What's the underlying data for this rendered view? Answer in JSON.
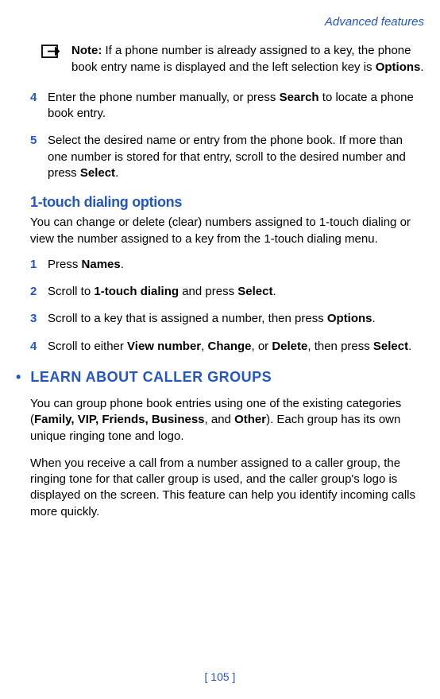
{
  "header": {
    "title": "Advanced features"
  },
  "note": {
    "label": "Note:",
    "text": " If a phone number is already assigned to a key, the phone book entry name is displayed and the left selection key is ",
    "bold_end": "Options",
    "period": "."
  },
  "steps_a": [
    {
      "num": "4",
      "text_before": "Enter the phone number manually, or press ",
      "bold1": "Search",
      "text_after": " to locate a phone book entry."
    },
    {
      "num": "5",
      "text_before": "Select the desired name or entry from the phone book. If more than one number is stored for that entry, scroll to the desired number and press ",
      "bold1": "Select",
      "text_after": "."
    }
  ],
  "subheading": "1-touch dialing options",
  "intro": "You can change or delete (clear) numbers assigned to 1-touch dialing or view the number assigned to a key from the 1-touch dialing menu.",
  "steps_b": [
    {
      "num": "1",
      "parts": [
        {
          "t": "Press "
        },
        {
          "b": "Names"
        },
        {
          "t": "."
        }
      ]
    },
    {
      "num": "2",
      "parts": [
        {
          "t": "Scroll to "
        },
        {
          "b": "1-touch dialing"
        },
        {
          "t": " and press "
        },
        {
          "b": "Select"
        },
        {
          "t": "."
        }
      ]
    },
    {
      "num": "3",
      "parts": [
        {
          "t": "Scroll to a key that is assigned a number, then press "
        },
        {
          "b": "Options"
        },
        {
          "t": "."
        }
      ]
    },
    {
      "num": "4",
      "parts": [
        {
          "t": "Scroll to either "
        },
        {
          "b": "View number"
        },
        {
          "t": ", "
        },
        {
          "b": "Change"
        },
        {
          "t": ", or "
        },
        {
          "b": "Delete"
        },
        {
          "t": ", then press "
        },
        {
          "b": "Select"
        },
        {
          "t": "."
        }
      ]
    }
  ],
  "section": {
    "bullet": "•",
    "heading": "LEARN ABOUT CALLER GROUPS"
  },
  "para1_parts": [
    {
      "t": "You can group phone book entries using one of the existing categories ("
    },
    {
      "b": "Family, VIP, Friends, Business"
    },
    {
      "t": ", and "
    },
    {
      "b": "Other"
    },
    {
      "t": "). Each group has its own unique ringing tone and logo."
    }
  ],
  "para2": "When you receive a call from a number assigned to a caller group, the ringing tone for that caller group is used, and the caller group's logo is displayed on the screen. This feature can help you identify incoming calls more quickly.",
  "page_num": "[ 105 ]"
}
